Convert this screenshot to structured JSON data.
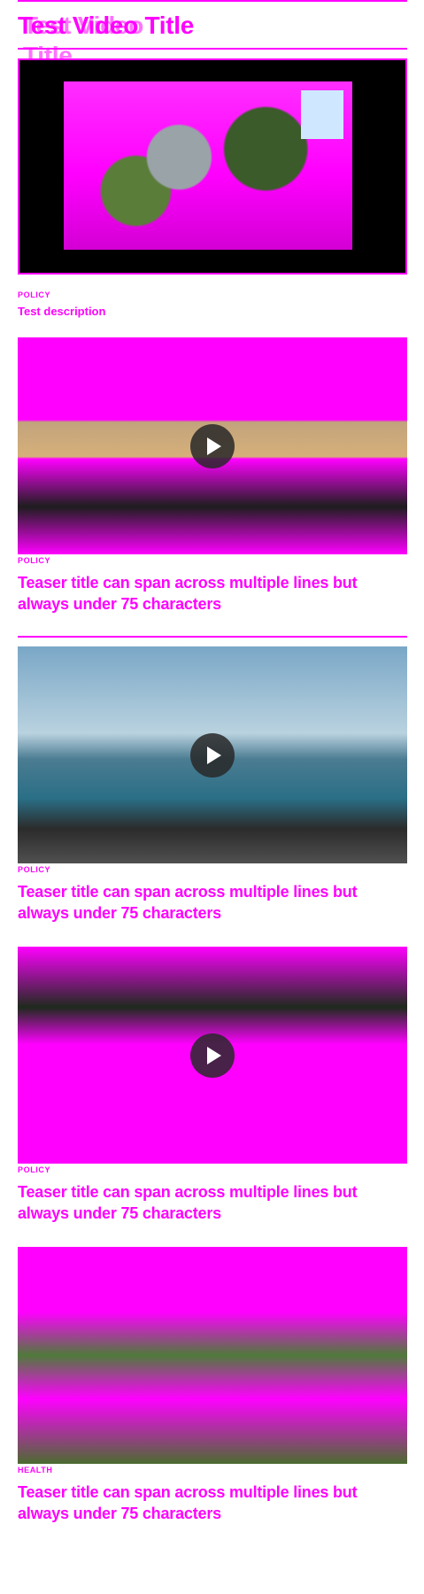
{
  "page": {
    "title": "Test Video Title"
  },
  "featured": {
    "label": "POLICY",
    "description": "Test description"
  },
  "teasers": [
    {
      "label": "POLICY",
      "title": "Teaser title can span across multiple lines but always under 75 characters"
    },
    {
      "label": "POLICY",
      "title": "Teaser title can span across multiple lines but always under 75 characters"
    },
    {
      "label": "POLICY",
      "title": "Teaser title can span across multiple lines but always under 75 characters"
    },
    {
      "label": "HEALTH",
      "title": "Teaser title can span across multiple lines but always under 75 characters"
    }
  ],
  "colors": {
    "accent": "#ff00ff"
  },
  "icons": {
    "play": "play-icon"
  }
}
